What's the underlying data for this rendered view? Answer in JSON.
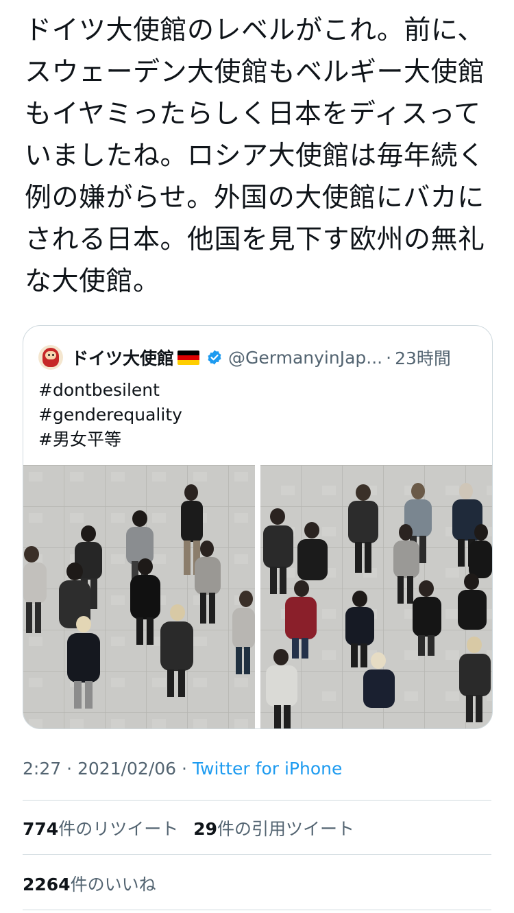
{
  "tweet": {
    "text": "ドイツ大使館のレベルがこれ。前に、\nスウェーデン大使館もベルギー大使館\nもイヤミったらしく日本をディスって\nいましたね。ロシア大使館は毎年続く\n例の嫌がらせ。外国の大使館にバカに\nされる日本。他国を見下す欧州の無礼\nな大使館。"
  },
  "quote": {
    "name": "ドイツ大使館",
    "flag_colors": [
      "#000000",
      "#dd0000",
      "#ffce00"
    ],
    "verified_icon": "verified-badge-icon",
    "handle": "@GermanyinJap...",
    "separator": "·",
    "time": "23時間",
    "hashtags": [
      "#dontbesilent",
      "#genderequality",
      "#男女平等"
    ],
    "photos": [
      "group-photo-left",
      "group-photo-right"
    ]
  },
  "meta": {
    "time": "2:27",
    "sep1": " · ",
    "date": "2021/02/06",
    "sep2": " · ",
    "source": "Twitter for iPhone"
  },
  "stats": {
    "retweets_count": "774",
    "retweets_label": "件のリツイート",
    "quotes_count": "29",
    "quotes_label": "件の引用ツイート",
    "likes_count": "2264",
    "likes_label": "件のいいね"
  },
  "colors": {
    "text": "#0f1419",
    "secondary": "#536471",
    "link": "#1d9bf0",
    "border": "#cfd9de"
  }
}
